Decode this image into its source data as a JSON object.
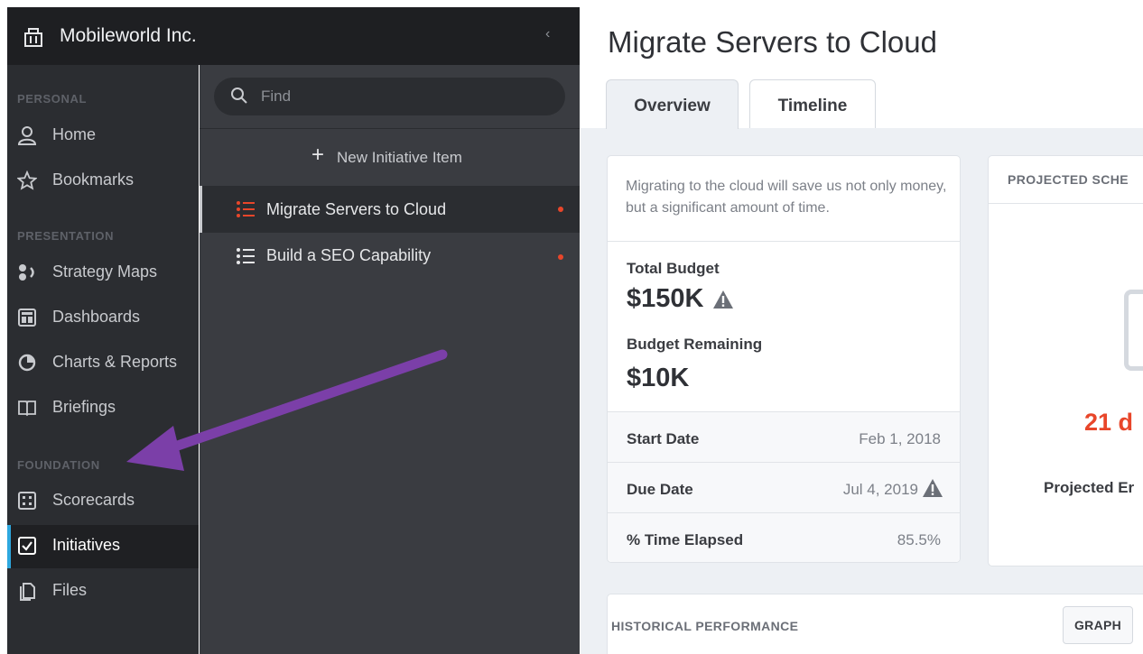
{
  "org": {
    "name": "Mobileworld Inc.",
    "icon": "building-icon",
    "collapse_icon": "chevron-left-icon"
  },
  "sidebar": {
    "sections": [
      {
        "label": "PERSONAL"
      },
      {
        "label": "PRESENTATION"
      },
      {
        "label": "FOUNDATION"
      }
    ],
    "items": [
      {
        "label": "Home",
        "icon": "user-icon"
      },
      {
        "label": "Bookmarks",
        "icon": "star-icon"
      },
      {
        "label": "Strategy Maps",
        "icon": "strategy-map-icon"
      },
      {
        "label": "Dashboards",
        "icon": "dashboard-icon"
      },
      {
        "label": "Charts & Reports",
        "icon": "pie-chart-icon"
      },
      {
        "label": "Briefings",
        "icon": "book-icon"
      },
      {
        "label": "Scorecards",
        "icon": "scorecard-icon"
      },
      {
        "label": "Initiatives",
        "icon": "checkbox-icon",
        "active": true
      },
      {
        "label": "Files",
        "icon": "files-icon"
      }
    ]
  },
  "list": {
    "search_placeholder": "Find",
    "new_item_label": "New Initiative Item",
    "items": [
      {
        "label": "Migrate Servers to Cloud",
        "active": true,
        "status_color": "#e8462a"
      },
      {
        "label": "Build a SEO Capability",
        "active": false,
        "status_color": "#e8462a"
      }
    ]
  },
  "main": {
    "title": "Migrate Servers to Cloud",
    "tabs": [
      {
        "label": "Overview",
        "active": true
      },
      {
        "label": "Timeline",
        "active": false
      }
    ],
    "summary": {
      "description": "Migrating to the cloud will save us not only money, but a significant amount of time.",
      "total_budget_label": "Total Budget",
      "total_budget_value": "$150K",
      "budget_remaining_label": "Budget Remaining",
      "budget_remaining_value": "$10K",
      "rows": [
        {
          "label": "Start Date",
          "value": "Feb 1, 2018"
        },
        {
          "label": "Due Date",
          "value": "Jul 4, 2019"
        },
        {
          "label": "% Time Elapsed",
          "value": "85.5%"
        }
      ]
    },
    "schedule": {
      "title": "PROJECTED SCHE",
      "days_text": "21 d",
      "end_label": "Projected Er"
    },
    "historical": {
      "title": "HISTORICAL PERFORMANCE",
      "graph_button": "GRAPH"
    }
  },
  "colors": {
    "accent": "#2ea8df",
    "alert": "#e8462a",
    "annotation_arrow": "#7b3fa8"
  }
}
